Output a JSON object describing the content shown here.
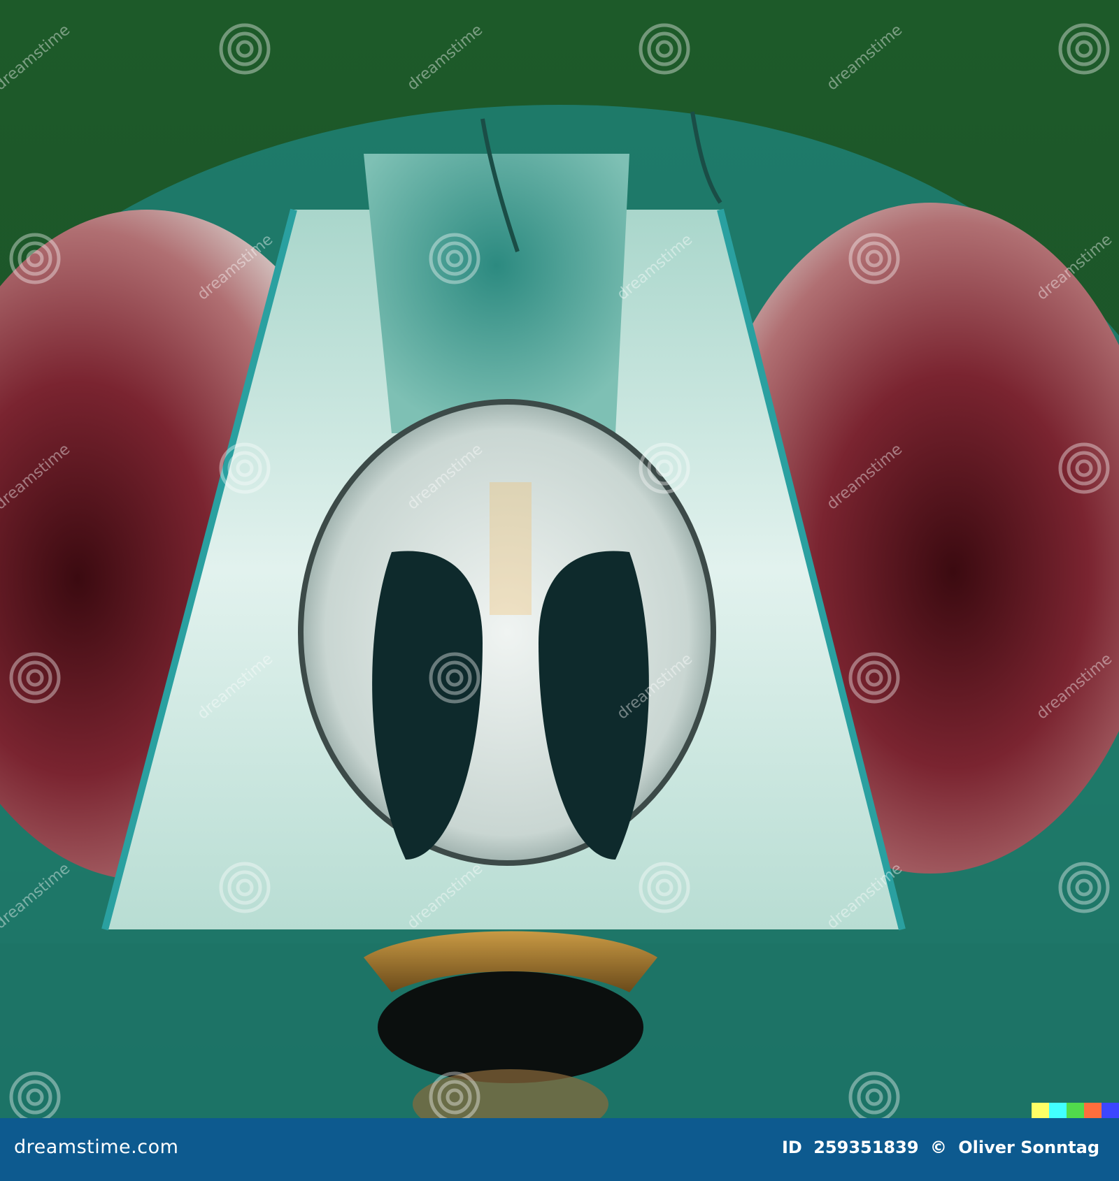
{
  "image": {
    "subject": "macro-insect-face",
    "colors": {
      "background": "#1e5a2a",
      "eye": "#8a3a42",
      "face": "#d8ece6",
      "footer": "#0d5a8f"
    }
  },
  "watermark": {
    "text": "dreamstime",
    "icon": "spiral-watermark-icon"
  },
  "footer": {
    "site": "dreamstime.com",
    "id_label": "ID",
    "id_value": "259351839",
    "copyright_symbol": "©",
    "author": "Oliver Sonntag"
  },
  "ai_badge": {
    "colors": [
      "#ffff66",
      "#42ffff",
      "#51da4c",
      "#ff6e3c",
      "#3c46ff"
    ]
  }
}
